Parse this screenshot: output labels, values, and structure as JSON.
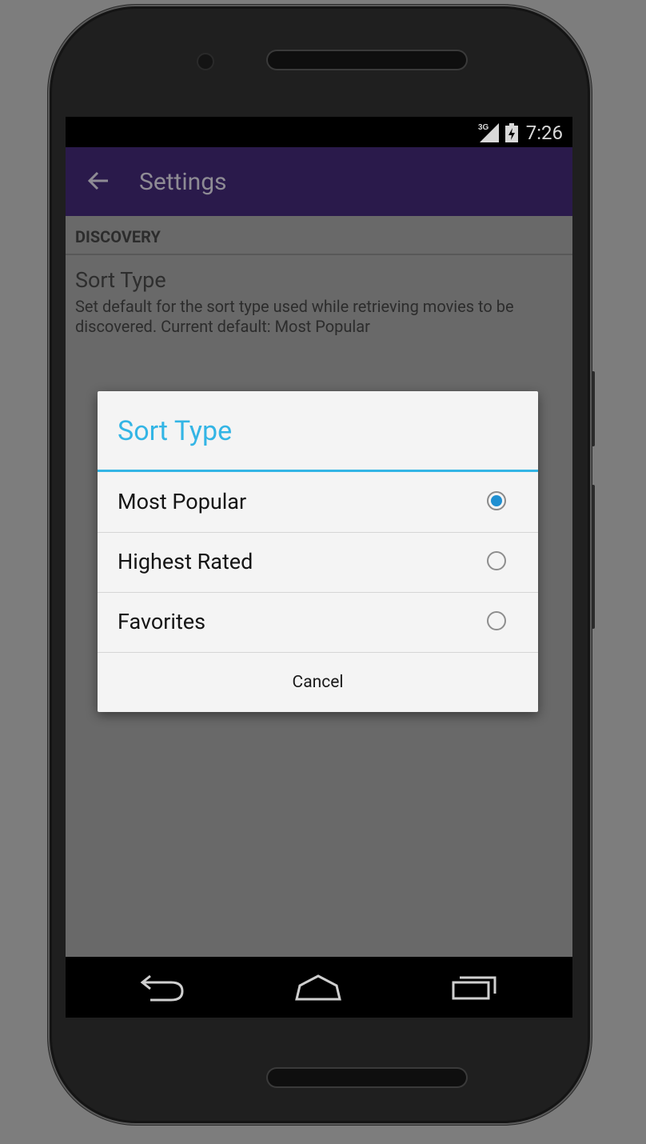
{
  "status_bar": {
    "network_label": "3G",
    "time": "7:26",
    "icons": [
      "signal-icon",
      "battery-icon"
    ]
  },
  "app_bar": {
    "title": "Settings",
    "back_icon": "back-arrow-icon",
    "color": "#2a1a4b"
  },
  "preferences": {
    "section_header": "DISCOVERY",
    "item": {
      "title": "Sort Type",
      "summary": "Set default for the sort type used while retrieving movies to be discovered. Current default: Most Popular"
    }
  },
  "dialog": {
    "title": "Sort Type",
    "accent_color": "#33b5e5",
    "options": [
      {
        "label": "Most Popular",
        "checked": true
      },
      {
        "label": "Highest Rated",
        "checked": false
      },
      {
        "label": "Favorites",
        "checked": false
      }
    ],
    "cancel_label": "Cancel"
  },
  "nav_bar": {
    "icons": [
      "back-icon",
      "home-icon",
      "recents-icon"
    ]
  }
}
